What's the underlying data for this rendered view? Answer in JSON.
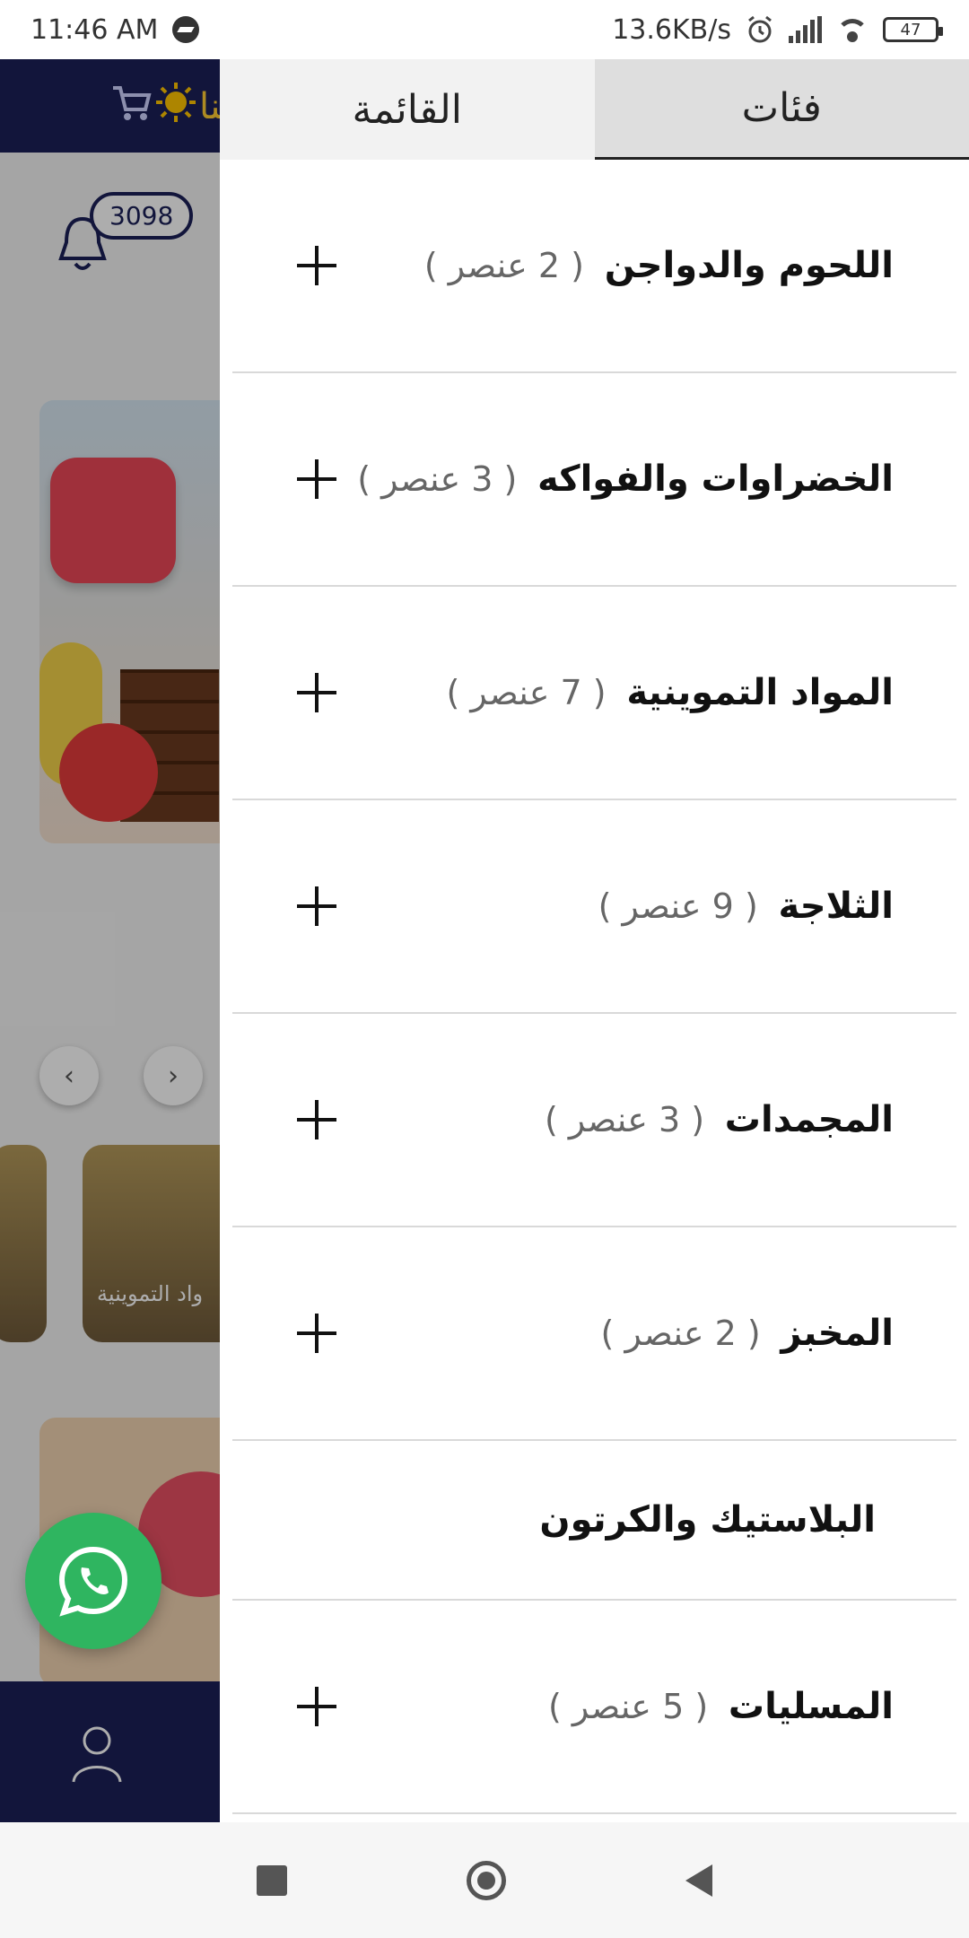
{
  "status_bar": {
    "time": "11:46 AM",
    "net_speed": "13.6KB/s",
    "battery": "47",
    "icons": [
      "messenger-icon",
      "alarm-icon",
      "signal-icon",
      "wifi-icon",
      "battery-icon"
    ]
  },
  "background": {
    "header_text": "تنا!",
    "notifications_count": "3098",
    "category_label": "واد التموينية"
  },
  "drawer": {
    "tabs": [
      {
        "label": "القائمة",
        "active": false
      },
      {
        "label": "فئات",
        "active": true
      }
    ],
    "categories": [
      {
        "name": "اللحوم والدواجن",
        "count": "( 2 عنصر )",
        "expandable": true
      },
      {
        "name": "الخضراوات والفواكه",
        "count": "( 3 عنصر )",
        "expandable": true
      },
      {
        "name": "المواد التموينية",
        "count": "( 7 عنصر )",
        "expandable": true
      },
      {
        "name": "الثلاجة",
        "count": "( 9 عنصر )",
        "expandable": true
      },
      {
        "name": "المجمدات",
        "count": "( 3 عنصر )",
        "expandable": true
      },
      {
        "name": "المخبز",
        "count": "( 2 عنصر )",
        "expandable": true
      },
      {
        "name": "البلاستيك والكرتون",
        "count": "",
        "expandable": false
      },
      {
        "name": "المسليات",
        "count": "( 5 عنصر )",
        "expandable": true
      }
    ]
  },
  "colors": {
    "brand_navy": "#1b2058",
    "whatsapp_green": "#2fb560",
    "active_tab_bg": "#dedede"
  }
}
